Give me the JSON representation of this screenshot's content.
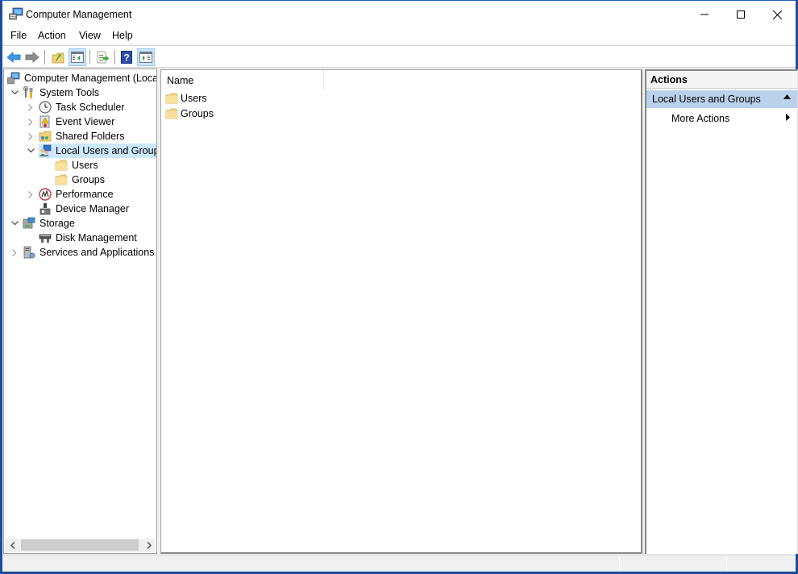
{
  "window": {
    "title": "Computer Management",
    "controls": {
      "minimize": "minimize",
      "maximize": "maximize",
      "close": "close"
    }
  },
  "menubar": {
    "items": [
      {
        "label": "File"
      },
      {
        "label": "Action"
      },
      {
        "label": "View"
      },
      {
        "label": "Help"
      }
    ]
  },
  "toolbar": {
    "buttons": [
      {
        "icon": "back-arrow-icon"
      },
      {
        "icon": "forward-arrow-icon"
      },
      {
        "icon": "up-folder-icon"
      },
      {
        "icon": "show-hide-console-tree-icon",
        "active": true
      },
      {
        "icon": "export-list-icon"
      },
      {
        "icon": "help-icon"
      },
      {
        "icon": "show-hide-action-pane-icon",
        "active": true
      }
    ]
  },
  "tree": {
    "root": "Computer Management (Local",
    "items": [
      {
        "label": "System Tools",
        "expanded": true
      },
      {
        "label": "Task Scheduler",
        "expanded": false
      },
      {
        "label": "Event Viewer",
        "expanded": false
      },
      {
        "label": "Shared Folders",
        "expanded": false
      },
      {
        "label": "Local Users and Groups",
        "expanded": true,
        "selected": true
      },
      {
        "label": "Users"
      },
      {
        "label": "Groups"
      },
      {
        "label": "Performance",
        "expanded": false
      },
      {
        "label": "Device Manager"
      },
      {
        "label": "Storage",
        "expanded": true
      },
      {
        "label": "Disk Management"
      },
      {
        "label": "Services and Applications",
        "expanded": false
      }
    ]
  },
  "content": {
    "columns": [
      {
        "label": "Name"
      }
    ],
    "rows": [
      {
        "name": "Users"
      },
      {
        "name": "Groups"
      }
    ]
  },
  "actions": {
    "header": "Actions",
    "section": "Local Users and Groups",
    "items": [
      {
        "label": "More Actions"
      }
    ]
  }
}
